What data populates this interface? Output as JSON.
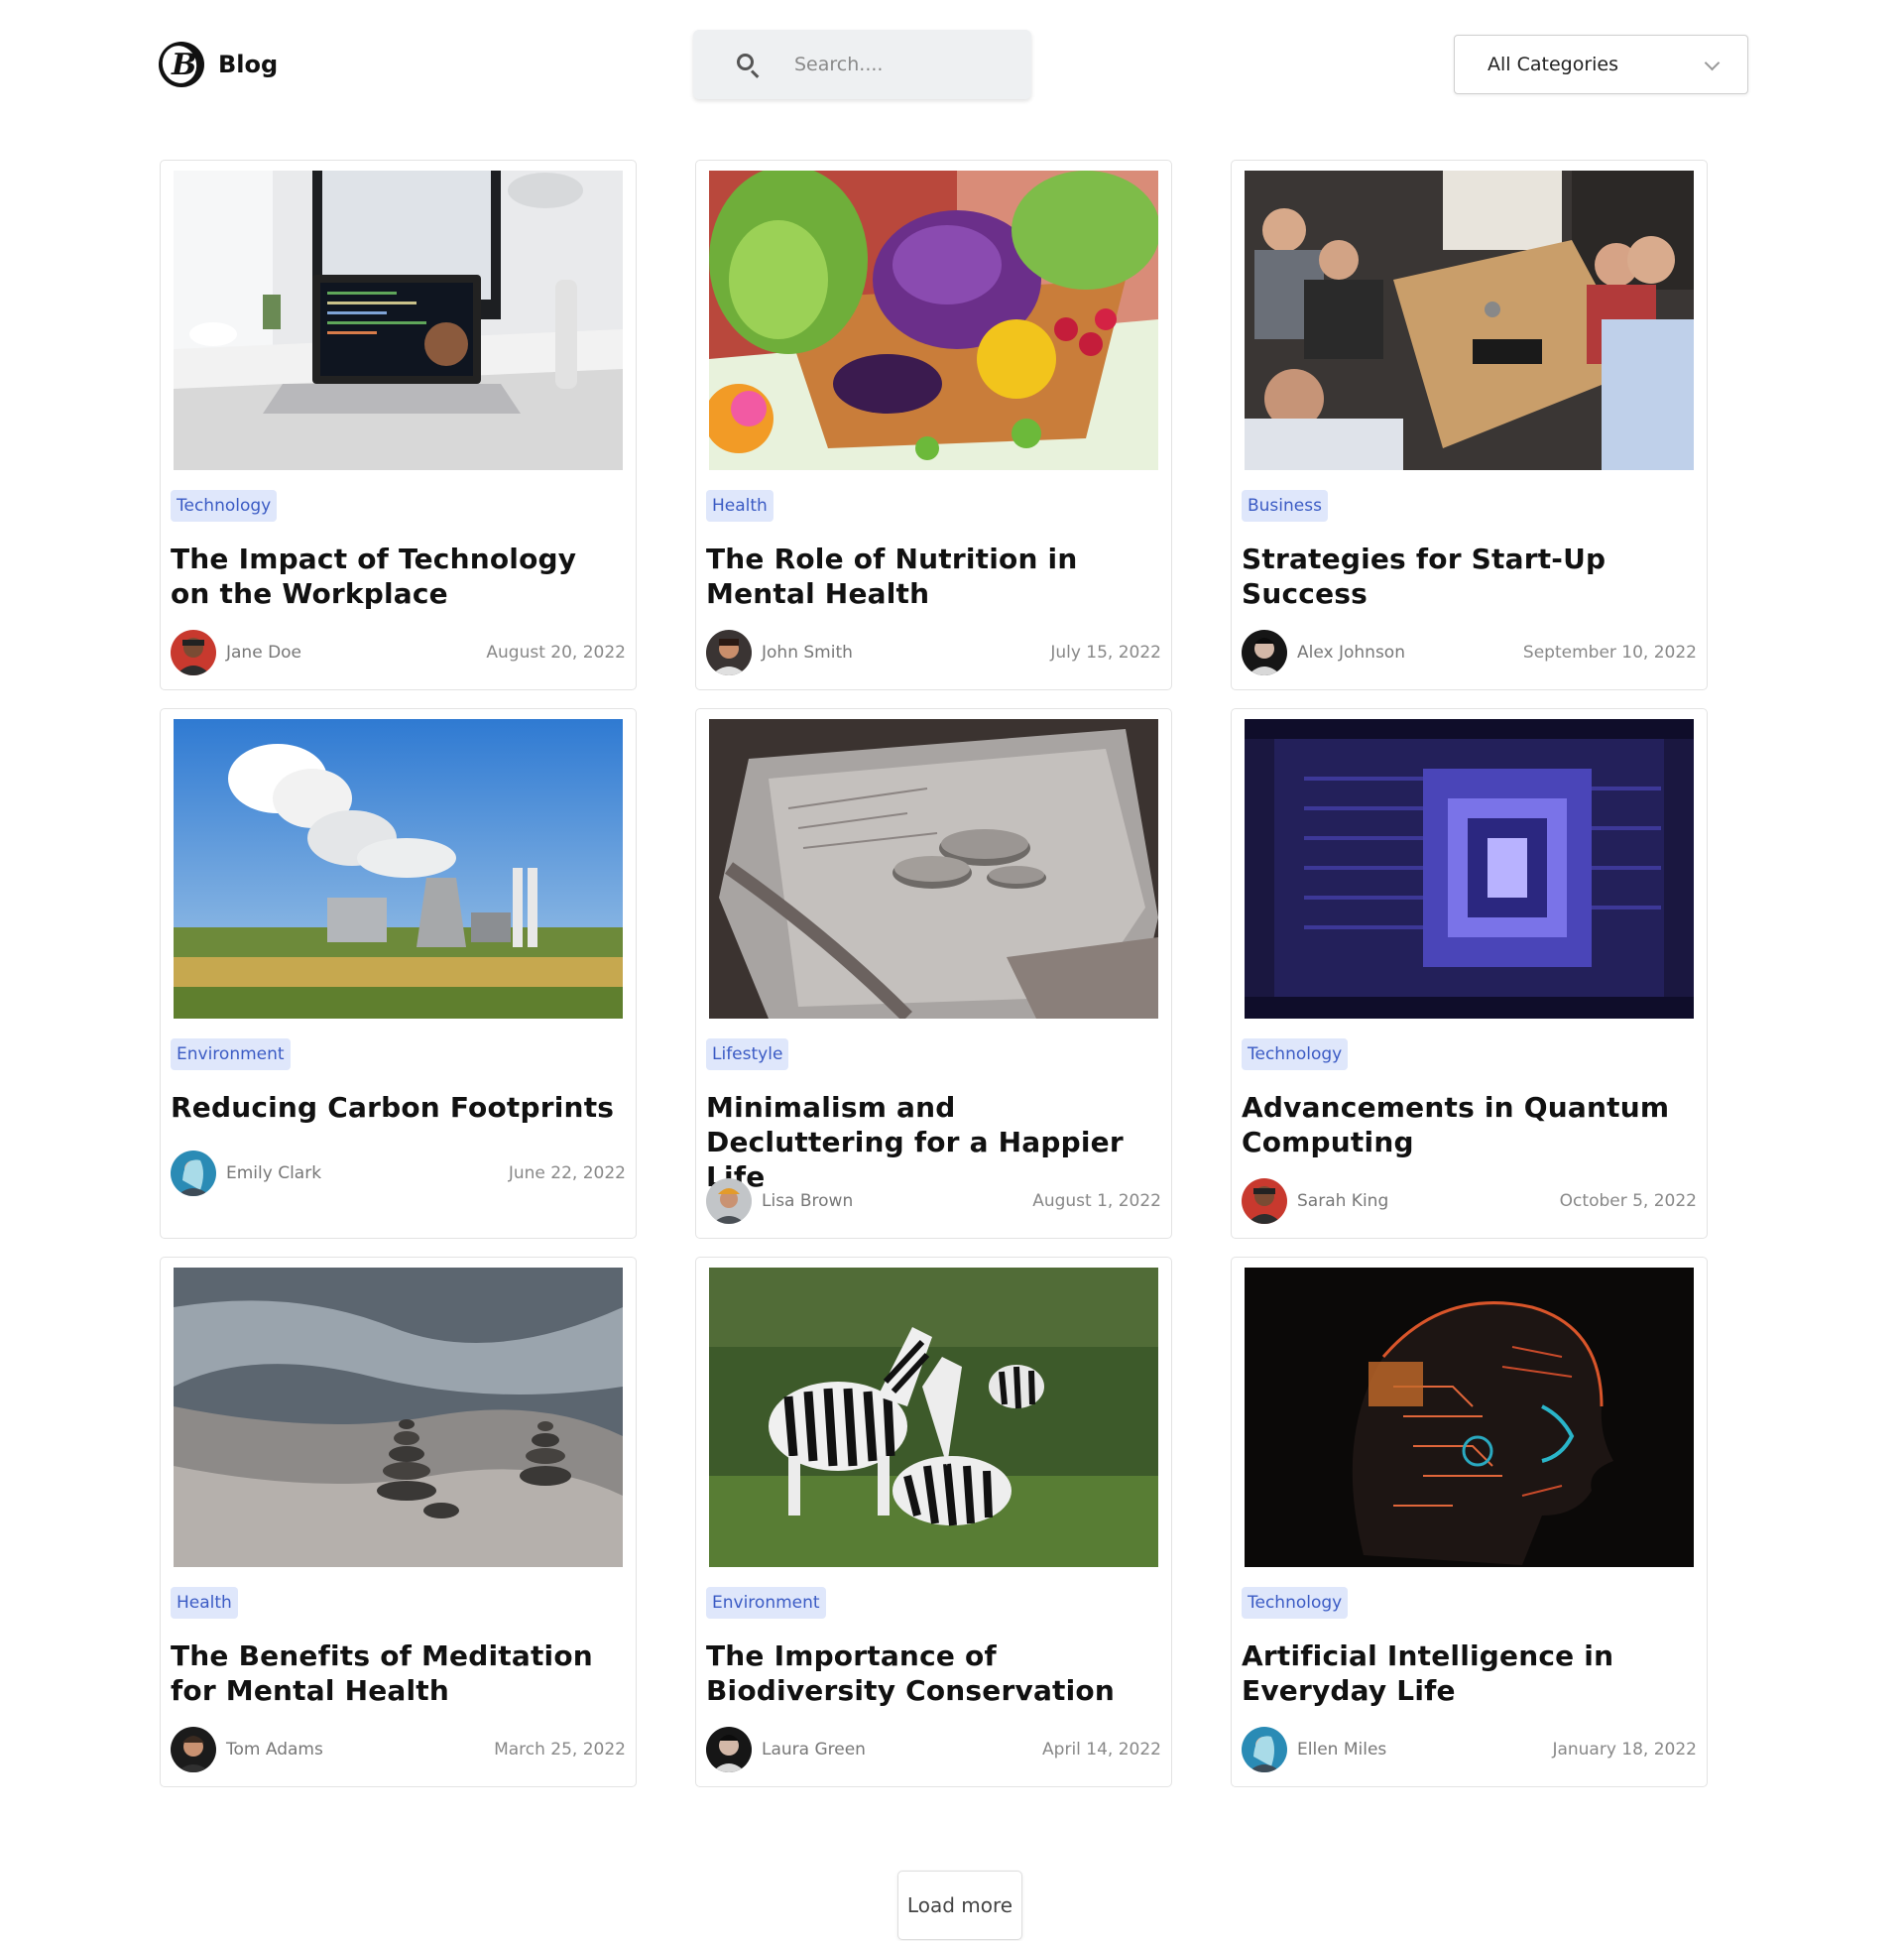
{
  "header": {
    "logo_letter": "B",
    "logo_text": "Blog",
    "search_placeholder": "Search....",
    "category_selected": "All Categories"
  },
  "posts": [
    {
      "category": "Technology",
      "title": "The Impact of Technology on the Workplace",
      "author": "Jane Doe",
      "date": "August 20, 2022",
      "image": "laptop-desk-photo"
    },
    {
      "category": "Health",
      "title": "The Role of Nutrition in Mental Health",
      "author": "John Smith",
      "date": "July 15, 2022",
      "image": "vegetable-basket-photo"
    },
    {
      "category": "Business",
      "title": "Strategies for Start-Up Success",
      "author": "Alex Johnson",
      "date": "September 10, 2022",
      "image": "team-meeting-photo"
    },
    {
      "category": "Environment",
      "title": "Reducing Carbon Footprints",
      "author": "Emily Clark",
      "date": "June 22, 2022",
      "image": "power-plant-photo"
    },
    {
      "category": "Lifestyle",
      "title": "Minimalism and Decluttering for a Happier Life",
      "author": "Lisa Brown",
      "date": "August 1, 2022",
      "image": "coins-on-paper-photo"
    },
    {
      "category": "Technology",
      "title": "Advancements in Quantum Computing",
      "author": "Sarah King",
      "date": "October 5, 2022",
      "image": "quantum-chip-photo"
    },
    {
      "category": "Health",
      "title": "The Benefits of Meditation for Mental Health",
      "author": "Tom Adams",
      "date": "March 25, 2022",
      "image": "stacked-stones-photo"
    },
    {
      "category": "Environment",
      "title": "The Importance of Biodiversity Conservation",
      "author": "Laura Green",
      "date": "April 14, 2022",
      "image": "zebras-photo"
    },
    {
      "category": "Technology",
      "title": "Artificial Intelligence in Everyday Life",
      "author": "Ellen Miles",
      "date": "January 18, 2022",
      "image": "ai-head-circuit-photo"
    }
  ],
  "load_more_label": "Load more",
  "colors": {
    "badge_bg": "#dfe7fb",
    "badge_text": "#3b5bc4",
    "search_bg": "#eef0f2"
  }
}
